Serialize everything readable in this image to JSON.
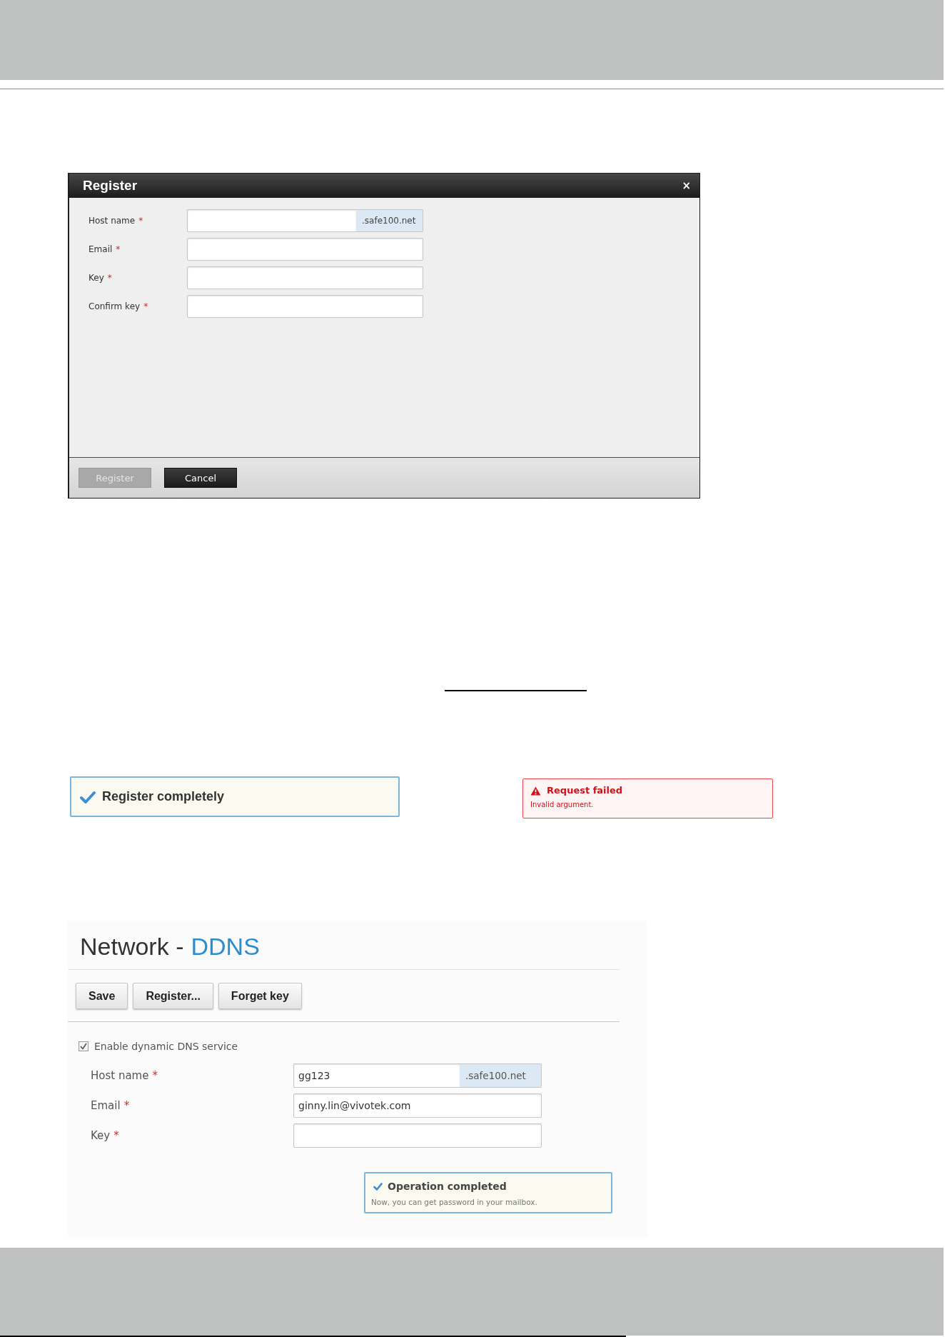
{
  "register_dialog": {
    "title": "Register",
    "close": "×",
    "fields": [
      {
        "label": "Host name",
        "required_mark": "*",
        "suffix": ".safe100.net"
      },
      {
        "label": "Email",
        "required_mark": "*"
      },
      {
        "label": "Key",
        "required_mark": "*"
      },
      {
        "label": "Confirm key",
        "required_mark": "*"
      }
    ],
    "buttons": [
      {
        "label": "Register",
        "disabled": true
      },
      {
        "label": "Cancel",
        "disabled": false
      }
    ]
  },
  "messages": [
    {
      "kind": "success",
      "title": "Register completely"
    },
    {
      "kind": "error",
      "title": "Request failed",
      "detail": "Invalid argument."
    }
  ],
  "ddns_page": {
    "title_section": "Network -",
    "title_page": "DDNS",
    "toolbar": [
      {
        "label": "Save"
      },
      {
        "label": "Register..."
      },
      {
        "label": "Forget key"
      }
    ],
    "enable_ddns": {
      "label": "Enable dynamic DNS service",
      "checked": true
    },
    "fields": [
      {
        "label": "Host name",
        "required_mark": "*",
        "value": "gg123",
        "suffix": ".safe100.net"
      },
      {
        "label": "Email",
        "required_mark": "*",
        "value": "ginny.lin@vivotek.com"
      },
      {
        "label": "Key",
        "required_mark": "*"
      }
    ],
    "notice": {
      "kind": "success",
      "title": "Operation completed",
      "detail": "Now, you can get password in your mailbox."
    }
  }
}
